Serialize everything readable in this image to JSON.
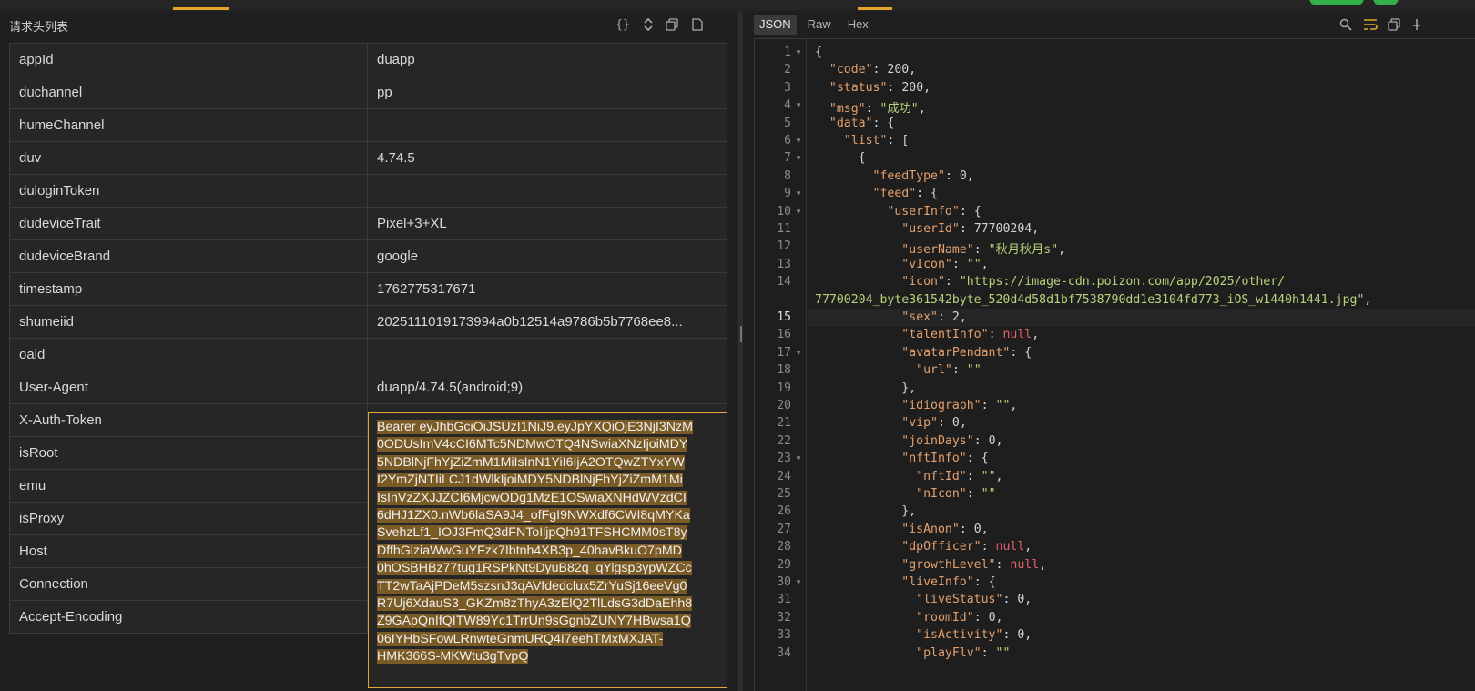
{
  "left": {
    "title": "请求头列表",
    "tools": [
      "{}",
      "⇕",
      "⧉",
      "🗋"
    ],
    "rows": [
      {
        "key": "appId",
        "value": "duapp"
      },
      {
        "key": "duchannel",
        "value": "pp"
      },
      {
        "key": "humeChannel",
        "value": ""
      },
      {
        "key": "duv",
        "value": "4.74.5"
      },
      {
        "key": "duloginToken",
        "value": ""
      },
      {
        "key": "dudeviceTrait",
        "value": "Pixel+3+XL"
      },
      {
        "key": "dudeviceBrand",
        "value": "google"
      },
      {
        "key": "timestamp",
        "value": "1762775317671"
      },
      {
        "key": "shumeiid",
        "value": "2025111019173994a0b12514a9786b5b7768ee8..."
      },
      {
        "key": "oaid",
        "value": ""
      },
      {
        "key": "User-Agent",
        "value": "duapp/4.74.5(android;9)"
      },
      {
        "key": "X-Auth-Token",
        "value": ""
      },
      {
        "key": "isRoot",
        "value": ""
      },
      {
        "key": "emu",
        "value": ""
      },
      {
        "key": "isProxy",
        "value": ""
      },
      {
        "key": "Host",
        "value": ""
      },
      {
        "key": "Connection",
        "value": ""
      },
      {
        "key": "Accept-Encoding",
        "value": ""
      }
    ],
    "token_lines": [
      "Bearer eyJhbGciOiJSUzI1NiJ9.eyJpYXQiOjE3NjI3NzM",
      "0ODUsImV4cCI6MTc5NDMwOTQ4NSwiaXNzIjoiMDY",
      "5NDBlNjFhYjZiZmM1MiIsInN1YiI6IjA2OTQwZTYxYW",
      "I2YmZjNTIiLCJ1dWlkIjoiMDY5NDBlNjFhYjZiZmM1Mi",
      "IsInVzZXJJZCI6MjcwODg1MzE1OSwiaXNHdWVzdCI",
      "6dHJ1ZX0.nWb6laSA9J4_ofFgI9NWXdf6CWI8qMYKa",
      "SvehzLf1_IOJ3FmQ3dFNToIljpQh91TFSHCMM0sT8y",
      "DffhGlziaWwGuYFzk7Ibtnh4XB3p_40havBkuO7pMD",
      "0hOSBHBz77tug1RSPkNt9DyuB82q_qYigsp3ypWZCc",
      "TT2wTaAjPDeM5szsnJ3qAVfdedclux5ZrYuSj16eeVg0",
      "R7Uj6XdauS3_GKZm8zThyA3zElQ2TlLdsG3dDaEhh8",
      "Z9GApQnIfQITW89Yc1TrrUn9sGgnbZUNY7HBwsa1Q",
      "06IYHbSFowLRnwteGnmURQ4I7eehTMxMXJAT-",
      "HMK366S-MKWtu3gTvpQ"
    ]
  },
  "right": {
    "tabs": [
      "JSON",
      "Raw",
      "Hex"
    ],
    "active_tab": "JSON",
    "current_line": 15,
    "fold_lines": [
      1,
      4,
      6,
      7,
      9,
      10,
      17,
      23,
      30
    ],
    "lines": [
      [
        [
          "p",
          "{"
        ]
      ],
      [
        [
          "p",
          "  "
        ],
        [
          "k",
          "\"code\""
        ],
        [
          "p",
          ": "
        ],
        [
          "n",
          "200"
        ],
        [
          "p",
          ","
        ]
      ],
      [
        [
          "p",
          "  "
        ],
        [
          "k",
          "\"status\""
        ],
        [
          "p",
          ": "
        ],
        [
          "n",
          "200"
        ],
        [
          "p",
          ","
        ]
      ],
      [
        [
          "p",
          "  "
        ],
        [
          "k",
          "\"msg\""
        ],
        [
          "p",
          ": "
        ],
        [
          "s",
          "\"成功\""
        ],
        [
          "p",
          ","
        ]
      ],
      [
        [
          "p",
          "  "
        ],
        [
          "k",
          "\"data\""
        ],
        [
          "p",
          ": {"
        ]
      ],
      [
        [
          "p",
          "    "
        ],
        [
          "k",
          "\"list\""
        ],
        [
          "p",
          ": ["
        ]
      ],
      [
        [
          "p",
          "      {"
        ]
      ],
      [
        [
          "p",
          "        "
        ],
        [
          "k",
          "\"feedType\""
        ],
        [
          "p",
          ": "
        ],
        [
          "n",
          "0"
        ],
        [
          "p",
          ","
        ]
      ],
      [
        [
          "p",
          "        "
        ],
        [
          "k",
          "\"feed\""
        ],
        [
          "p",
          ": {"
        ]
      ],
      [
        [
          "p",
          "          "
        ],
        [
          "k",
          "\"userInfo\""
        ],
        [
          "p",
          ": {"
        ]
      ],
      [
        [
          "p",
          "            "
        ],
        [
          "k",
          "\"userId\""
        ],
        [
          "p",
          ": "
        ],
        [
          "n",
          "77700204"
        ],
        [
          "p",
          ","
        ]
      ],
      [
        [
          "p",
          "            "
        ],
        [
          "k",
          "\"userName\""
        ],
        [
          "p",
          ": "
        ],
        [
          "s",
          "\"秋月秋月s\""
        ],
        [
          "p",
          ","
        ]
      ],
      [
        [
          "p",
          "            "
        ],
        [
          "k",
          "\"vIcon\""
        ],
        [
          "p",
          ": "
        ],
        [
          "s",
          "\"\""
        ],
        [
          "p",
          ","
        ]
      ],
      [
        [
          "p",
          "            "
        ],
        [
          "k",
          "\"icon\""
        ],
        [
          "p",
          ": "
        ],
        [
          "s",
          "\"https://image-cdn.poizon.com/app/2025/other/"
        ]
      ],
      [
        [
          "s",
          "77700204_byte361542byte_520d4d58d1bf7538790dd1e3104fd773_iOS_w1440h1441.jpg\""
        ],
        [
          "p",
          ","
        ]
      ],
      [
        [
          "p",
          "            "
        ],
        [
          "k",
          "\"sex\""
        ],
        [
          "p",
          ": "
        ],
        [
          "n",
          "2"
        ],
        [
          "p",
          ","
        ]
      ],
      [
        [
          "p",
          "            "
        ],
        [
          "k",
          "\"talentInfo\""
        ],
        [
          "p",
          ": "
        ],
        [
          "u",
          "null"
        ],
        [
          "p",
          ","
        ]
      ],
      [
        [
          "p",
          "            "
        ],
        [
          "k",
          "\"avatarPendant\""
        ],
        [
          "p",
          ": {"
        ]
      ],
      [
        [
          "p",
          "              "
        ],
        [
          "k",
          "\"url\""
        ],
        [
          "p",
          ": "
        ],
        [
          "s",
          "\"\""
        ]
      ],
      [
        [
          "p",
          "            },"
        ]
      ],
      [
        [
          "p",
          "            "
        ],
        [
          "k",
          "\"idiograph\""
        ],
        [
          "p",
          ": "
        ],
        [
          "s",
          "\"\""
        ],
        [
          "p",
          ","
        ]
      ],
      [
        [
          "p",
          "            "
        ],
        [
          "k",
          "\"vip\""
        ],
        [
          "p",
          ": "
        ],
        [
          "n",
          "0"
        ],
        [
          "p",
          ","
        ]
      ],
      [
        [
          "p",
          "            "
        ],
        [
          "k",
          "\"joinDays\""
        ],
        [
          "p",
          ": "
        ],
        [
          "n",
          "0"
        ],
        [
          "p",
          ","
        ]
      ],
      [
        [
          "p",
          "            "
        ],
        [
          "k",
          "\"nftInfo\""
        ],
        [
          "p",
          ": {"
        ]
      ],
      [
        [
          "p",
          "              "
        ],
        [
          "k",
          "\"nftId\""
        ],
        [
          "p",
          ": "
        ],
        [
          "s",
          "\"\""
        ],
        [
          "p",
          ","
        ]
      ],
      [
        [
          "p",
          "              "
        ],
        [
          "k",
          "\"nIcon\""
        ],
        [
          "p",
          ": "
        ],
        [
          "s",
          "\"\""
        ]
      ],
      [
        [
          "p",
          "            },"
        ]
      ],
      [
        [
          "p",
          "            "
        ],
        [
          "k",
          "\"isAnon\""
        ],
        [
          "p",
          ": "
        ],
        [
          "n",
          "0"
        ],
        [
          "p",
          ","
        ]
      ],
      [
        [
          "p",
          "            "
        ],
        [
          "k",
          "\"dpOfficer\""
        ],
        [
          "p",
          ": "
        ],
        [
          "u",
          "null"
        ],
        [
          "p",
          ","
        ]
      ],
      [
        [
          "p",
          "            "
        ],
        [
          "k",
          "\"growthLevel\""
        ],
        [
          "p",
          ": "
        ],
        [
          "u",
          "null"
        ],
        [
          "p",
          ","
        ]
      ],
      [
        [
          "p",
          "            "
        ],
        [
          "k",
          "\"liveInfo\""
        ],
        [
          "p",
          ": {"
        ]
      ],
      [
        [
          "p",
          "              "
        ],
        [
          "k",
          "\"liveStatus\""
        ],
        [
          "p",
          ": "
        ],
        [
          "n",
          "0"
        ],
        [
          "p",
          ","
        ]
      ],
      [
        [
          "p",
          "              "
        ],
        [
          "k",
          "\"roomId\""
        ],
        [
          "p",
          ": "
        ],
        [
          "n",
          "0"
        ],
        [
          "p",
          ","
        ]
      ],
      [
        [
          "p",
          "              "
        ],
        [
          "k",
          "\"isActivity\""
        ],
        [
          "p",
          ": "
        ],
        [
          "n",
          "0"
        ],
        [
          "p",
          ","
        ]
      ],
      [
        [
          "p",
          "              "
        ],
        [
          "k",
          "\"playFlv\""
        ],
        [
          "p",
          ": "
        ],
        [
          "s",
          "\"\""
        ]
      ]
    ],
    "line_numbers": [
      1,
      2,
      3,
      4,
      5,
      6,
      7,
      8,
      9,
      10,
      11,
      12,
      13,
      14,
      null,
      15,
      16,
      17,
      18,
      19,
      20,
      21,
      22,
      23,
      24,
      25,
      26,
      27,
      28,
      29,
      30,
      31,
      32,
      33,
      34
    ]
  }
}
